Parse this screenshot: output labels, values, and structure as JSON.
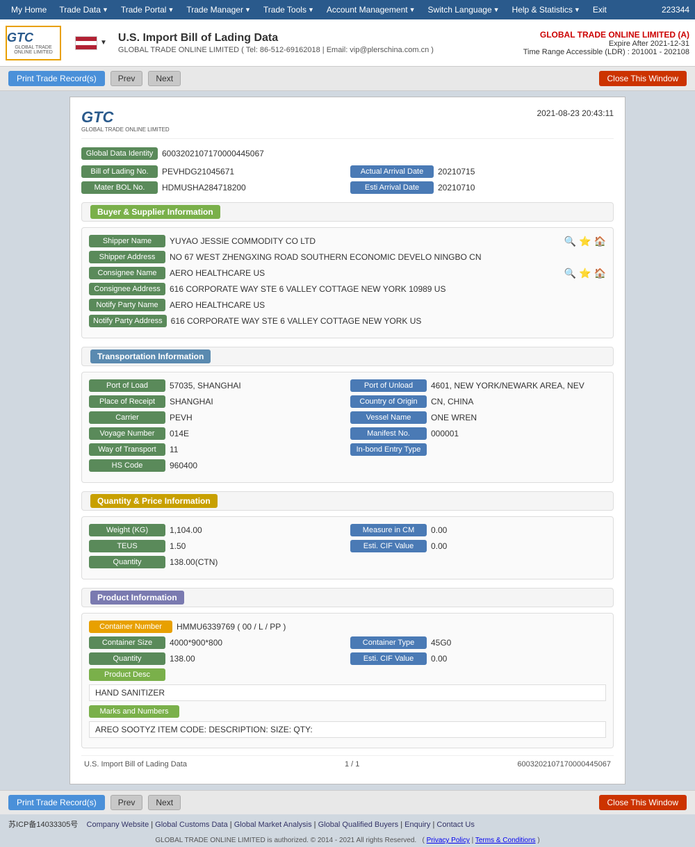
{
  "nav": {
    "items": [
      "My Home",
      "Trade Data",
      "Trade Portal",
      "Trade Manager",
      "Trade Tools",
      "Account Management",
      "Switch Language",
      "Help & Statistics",
      "Exit"
    ],
    "user_id": "223344"
  },
  "header": {
    "logo_main": "GTC",
    "logo_sub": "GLOBAL TRADE ONLINE LIMITED",
    "flag_label": "US Flag",
    "title": "U.S. Import Bill of Lading Data",
    "subtitle": "GLOBAL TRADE ONLINE LIMITED ( Tel: 86-512-69162018 | Email: vip@plerschina.com.cn )",
    "company": "GLOBAL TRADE ONLINE LIMITED (A)",
    "expire": "Expire After 2021-12-31",
    "time_range": "Time Range Accessible (LDR) : 201001 - 202108"
  },
  "toolbar": {
    "print_label": "Print Trade Record(s)",
    "prev_label": "Prev",
    "next_label": "Next",
    "close_label": "Close This Window"
  },
  "report": {
    "logo": "GTC",
    "logo_sub": "GLOBAL TRADE ONLINE LIMITED",
    "datetime": "2021-08-23 20:43:11",
    "global_data_id_label": "Global Data Identity",
    "global_data_id_value": "6003202107170000445067",
    "bol_no_label": "Bill of Lading No.",
    "bol_no_value": "PEVHDG21045671",
    "actual_arrival_label": "Actual Arrival Date",
    "actual_arrival_value": "20210715",
    "master_bol_label": "Mater BOL No.",
    "master_bol_value": "HDMUSHA284718200",
    "esti_arrival_label": "Esti Arrival Date",
    "esti_arrival_value": "20210710"
  },
  "buyer_supplier": {
    "section_label": "Buyer & Supplier Information",
    "shipper_name_label": "Shipper Name",
    "shipper_name_value": "YUYAO JESSIE COMMODITY CO LTD",
    "shipper_addr_label": "Shipper Address",
    "shipper_addr_value": "NO 67 WEST ZHENGXING ROAD SOUTHERN ECONOMIC DEVELO NINGBO CN",
    "consignee_name_label": "Consignee Name",
    "consignee_name_value": "AERO HEALTHCARE US",
    "consignee_addr_label": "Consignee Address",
    "consignee_addr_value": "616 CORPORATE WAY STE 6 VALLEY COTTAGE NEW YORK 10989 US",
    "notify_party_name_label": "Notify Party Name",
    "notify_party_name_value": "AERO HEALTHCARE US",
    "notify_party_addr_label": "Notify Party Address",
    "notify_party_addr_value": "616 CORPORATE WAY STE 6 VALLEY COTTAGE NEW YORK US"
  },
  "transportation": {
    "section_label": "Transportation Information",
    "port_of_load_label": "Port of Load",
    "port_of_load_value": "57035, SHANGHAI",
    "port_of_unload_label": "Port of Unload",
    "port_of_unload_value": "4601, NEW YORK/NEWARK AREA, NEV",
    "place_of_receipt_label": "Place of Receipt",
    "place_of_receipt_value": "SHANGHAI",
    "country_of_origin_label": "Country of Origin",
    "country_of_origin_value": "CN, CHINA",
    "carrier_label": "Carrier",
    "carrier_value": "PEVH",
    "vessel_name_label": "Vessel Name",
    "vessel_name_value": "ONE WREN",
    "voyage_number_label": "Voyage Number",
    "voyage_number_value": "014E",
    "manifest_no_label": "Manifest No.",
    "manifest_no_value": "000001",
    "way_of_transport_label": "Way of Transport",
    "way_of_transport_value": "11",
    "in_bond_label": "In-bond Entry Type",
    "in_bond_value": "",
    "hs_code_label": "HS Code",
    "hs_code_value": "960400"
  },
  "quantity_price": {
    "section_label": "Quantity & Price Information",
    "weight_label": "Weight (KG)",
    "weight_value": "1,104.00",
    "measure_label": "Measure in CM",
    "measure_value": "0.00",
    "teus_label": "TEUS",
    "teus_value": "1.50",
    "esti_cif_label": "Esti. CIF Value",
    "esti_cif_value": "0.00",
    "quantity_label": "Quantity",
    "quantity_value": "138.00(CTN)"
  },
  "product": {
    "section_label": "Product Information",
    "container_number_label": "Container Number",
    "container_number_value": "HMMU6339769 ( 00 / L / PP )",
    "container_size_label": "Container Size",
    "container_size_value": "4000*900*800",
    "container_type_label": "Container Type",
    "container_type_value": "45G0",
    "quantity_label": "Quantity",
    "quantity_value": "138.00",
    "esti_cif_label": "Esti. CIF Value",
    "esti_cif_value": "0.00",
    "product_desc_label": "Product Desc",
    "product_desc_value": "HAND SANITIZER",
    "marks_numbers_label": "Marks and Numbers",
    "marks_numbers_value": "AREO SOOTYZ ITEM CODE: DESCRIPTION: SIZE: QTY:"
  },
  "page_footer": {
    "page_label": "U.S. Import Bill of Lading Data",
    "page_num": "1 / 1",
    "record_id": "6003202107170000445067"
  },
  "footer": {
    "icp": "苏ICP备14033305号",
    "links": [
      "Company Website",
      "Global Customs Data",
      "Global Market Analysis",
      "Global Qualified Buyers",
      "Enquiry",
      "Contact Us"
    ],
    "copyright": "GLOBAL TRADE ONLINE LIMITED is authorized. © 2014 - 2021 All rights Reserved.",
    "privacy": "Privacy Policy",
    "terms": "Terms & Conditions"
  }
}
